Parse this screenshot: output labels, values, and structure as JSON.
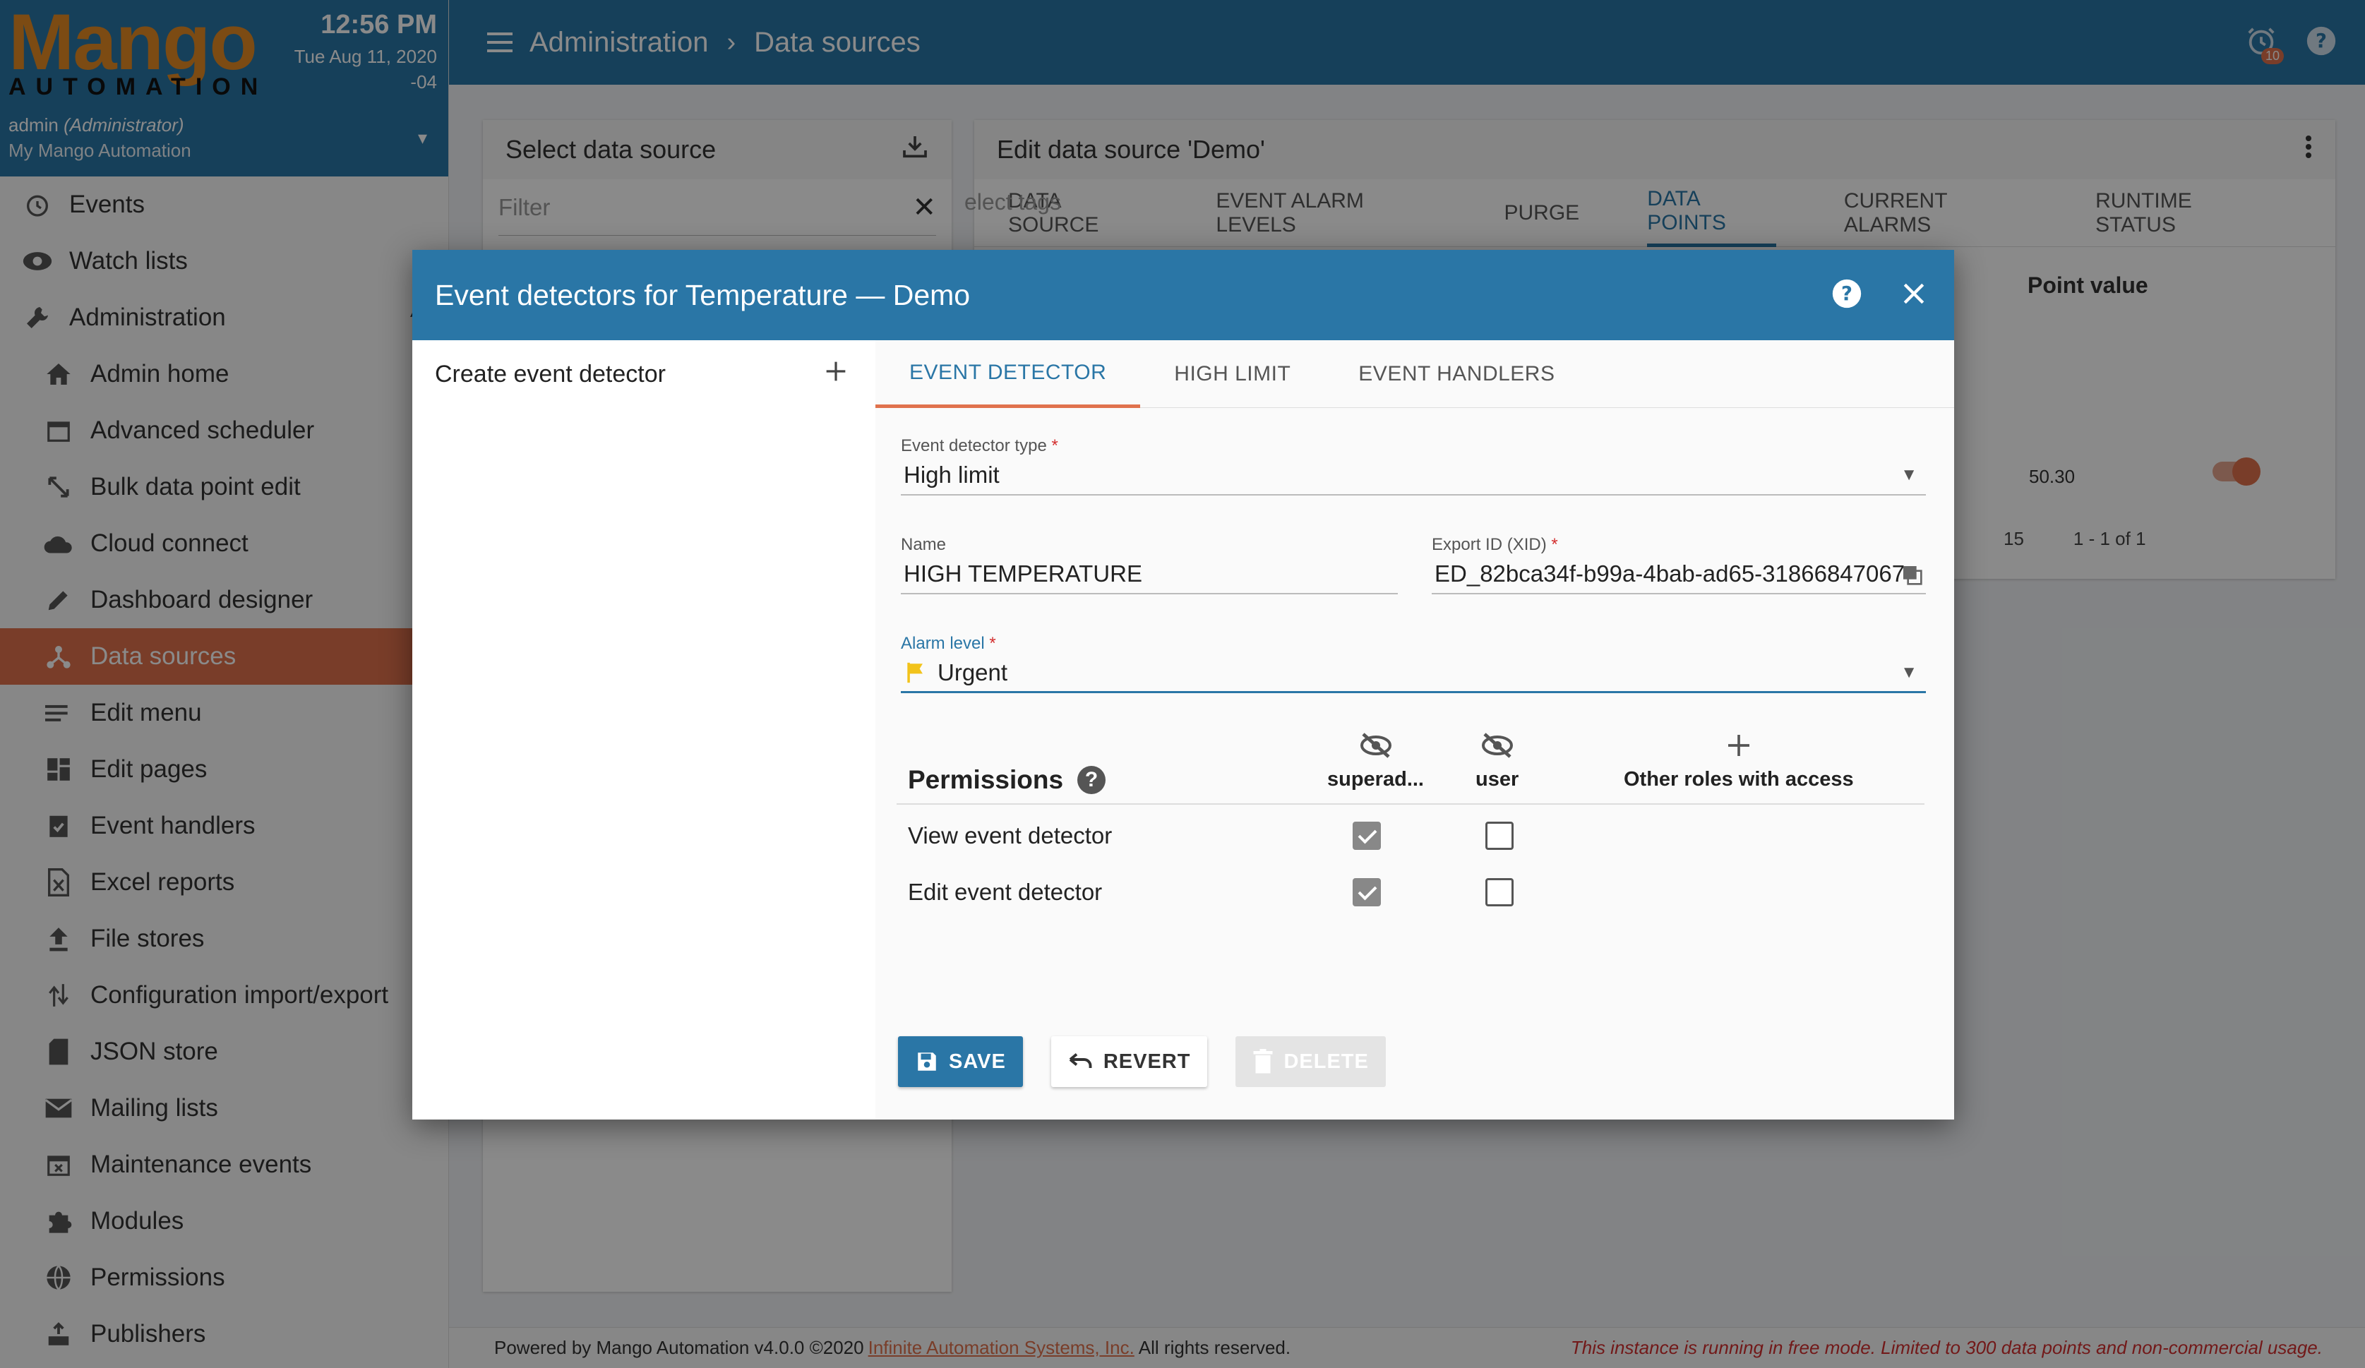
{
  "app": {
    "logo_main": "Mango",
    "logo_sub": "AUTOMATION",
    "time": "12:56 PM",
    "date_line1": "Tue Aug 11, 2020",
    "date_line2": "-04",
    "user": "admin",
    "user_role": "(Administrator)",
    "instance": "My Mango Automation"
  },
  "sidebar": {
    "items": [
      {
        "label": "Events",
        "icon": "alarm-clock-icon",
        "level": "top"
      },
      {
        "label": "Watch lists",
        "icon": "eye-icon",
        "level": "top"
      },
      {
        "label": "Administration",
        "icon": "wrench-icon",
        "level": "top"
      },
      {
        "label": "Admin home",
        "icon": "home-icon",
        "level": "sub"
      },
      {
        "label": "Advanced scheduler",
        "icon": "calendar-icon",
        "level": "sub"
      },
      {
        "label": "Bulk data point edit",
        "icon": "resize-icon",
        "level": "sub"
      },
      {
        "label": "Cloud connect",
        "icon": "cloud-icon",
        "level": "sub"
      },
      {
        "label": "Dashboard designer",
        "icon": "pencil-icon",
        "level": "sub"
      },
      {
        "label": "Data sources",
        "icon": "hub-icon",
        "level": "sub",
        "active": true
      },
      {
        "label": "Edit menu",
        "icon": "list-icon",
        "level": "sub"
      },
      {
        "label": "Edit pages",
        "icon": "dashboard-icon",
        "level": "sub"
      },
      {
        "label": "Event handlers",
        "icon": "clipboard-check-icon",
        "level": "sub"
      },
      {
        "label": "Excel reports",
        "icon": "excel-icon",
        "level": "sub"
      },
      {
        "label": "File stores",
        "icon": "upload-icon",
        "level": "sub"
      },
      {
        "label": "Configuration import/export",
        "icon": "swap-icon",
        "level": "sub"
      },
      {
        "label": "JSON store",
        "icon": "sd-card-icon",
        "level": "sub"
      },
      {
        "label": "Mailing lists",
        "icon": "mail-icon",
        "level": "sub"
      },
      {
        "label": "Maintenance events",
        "icon": "calendar-x-icon",
        "level": "sub"
      },
      {
        "label": "Modules",
        "icon": "puzzle-icon",
        "level": "sub"
      },
      {
        "label": "Permissions",
        "icon": "globe-lock-icon",
        "level": "sub"
      },
      {
        "label": "Publishers",
        "icon": "publish-icon",
        "level": "sub"
      }
    ]
  },
  "topbar": {
    "crumb1": "Administration",
    "crumb2": "Data sources",
    "alarm_count": "10"
  },
  "left_panel": {
    "title": "Select data source",
    "filter_placeholder": "Filter"
  },
  "right_panel": {
    "title": "Edit data source 'Demo'",
    "tabs": [
      "DATA SOURCE",
      "EVENT ALARM LEVELS",
      "PURGE",
      "DATA POINTS",
      "CURRENT ALARMS",
      "RUNTIME STATUS"
    ],
    "active_tab": "DATA POINTS",
    "tags_placeholder": "elect tags",
    "point_value_header": "Point value",
    "point_value": "50.30",
    "page_size": "15",
    "page_range": "1 - 1 of 1"
  },
  "footer": {
    "powered": "Powered by Mango Automation v4.0.0 ©2020",
    "company": "Infinite Automation Systems, Inc.",
    "rights": "All rights reserved.",
    "free_mode": "This instance is running in free mode. Limited to 300 data points and non-commercial usage."
  },
  "dialog": {
    "title": "Event detectors for Temperature — Demo",
    "create_label": "Create event detector",
    "tabs": [
      "EVENT DETECTOR",
      "HIGH LIMIT",
      "EVENT HANDLERS"
    ],
    "detector_type_label": "Event detector type",
    "detector_type_value": "High limit",
    "name_label": "Name",
    "name_value": "HIGH TEMPERATURE",
    "xid_label": "Export ID (XID)",
    "xid_value": "ED_82bca34f-b99a-4bab-ad65-31866847067",
    "alarm_label": "Alarm level",
    "alarm_value": "Urgent",
    "alarm_color": "#f2c31b",
    "permissions_title": "Permissions",
    "role1": "superad...",
    "role2": "user",
    "other_roles": "Other roles with access",
    "perm_view": "View event detector",
    "perm_edit": "Edit event detector",
    "save": "SAVE",
    "revert": "REVERT",
    "delete": "DELETE"
  },
  "colors": {
    "primary": "#2a76a6",
    "accent": "#e0724d",
    "logo_orange": "#e58b24"
  }
}
